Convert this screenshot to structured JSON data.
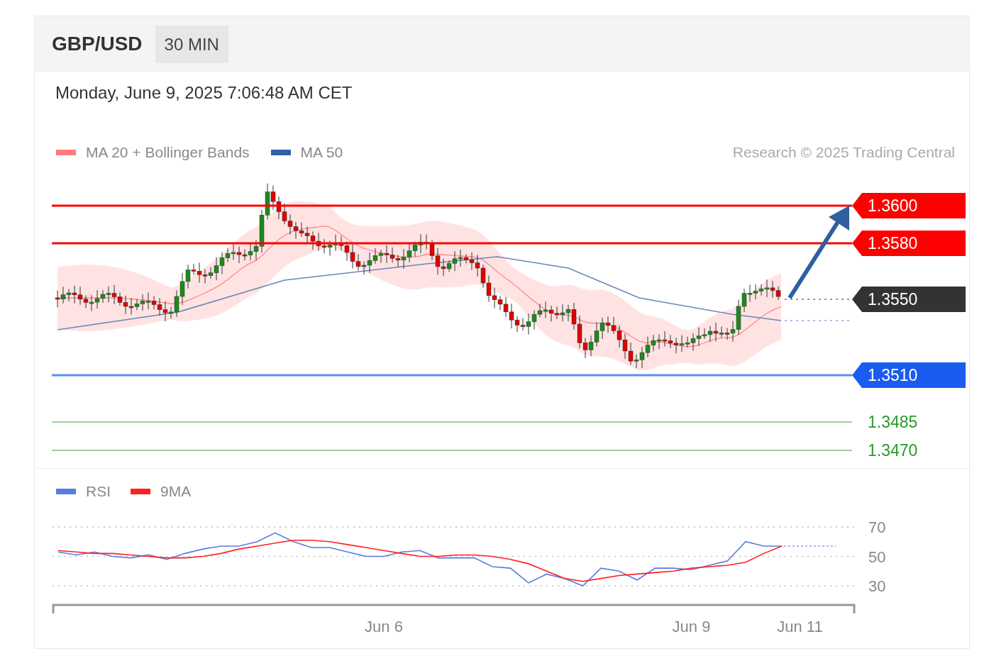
{
  "header": {
    "title": "GBP/USD",
    "interval": "30 MIN"
  },
  "timestamp": "Monday, June 9, 2025 7:06:48 AM CET",
  "price_chart": {
    "legend": [
      {
        "label": "MA 20 + Bollinger Bands",
        "color": "#ff7b7b"
      },
      {
        "label": "MA 50",
        "color": "#2f5fa8"
      }
    ],
    "credit": "Research © 2025 Trading Central",
    "levels": [
      {
        "label": "1.3600",
        "kind": "resistance"
      },
      {
        "label": "1.3580",
        "kind": "resistance"
      },
      {
        "label": "1.3550",
        "kind": "current"
      },
      {
        "label": "1.3510",
        "kind": "support"
      },
      {
        "label": "1.3485",
        "kind": "target"
      },
      {
        "label": "1.3470",
        "kind": "target"
      }
    ]
  },
  "rsi_panel": {
    "chart_data": {
      "type": "line",
      "categories": [
        null,
        null,
        null,
        null,
        null,
        null,
        null,
        null,
        null,
        null,
        null,
        null,
        null,
        null,
        null,
        null,
        null,
        null,
        "Jun 6",
        null,
        null,
        null,
        null,
        null,
        null,
        null,
        null,
        null,
        null,
        null,
        null,
        null,
        null,
        null,
        null,
        "Jun 9",
        null,
        null,
        null,
        null,
        null,
        "Jun 11",
        null,
        null
      ],
      "ylim": [
        17,
        70
      ],
      "yticks": [
        30,
        50,
        70
      ],
      "grid": true,
      "series": [
        {
          "name": "RSI",
          "color": "#5b7be0",
          "values": [
            53,
            51,
            53,
            50,
            49,
            51,
            48,
            52,
            55,
            57,
            57,
            60,
            66,
            60,
            56,
            56,
            53,
            50,
            50,
            53,
            54,
            49,
            49,
            49,
            43,
            42,
            32,
            38,
            35,
            30,
            42,
            40,
            34,
            42,
            42,
            41,
            44,
            47,
            60,
            57,
            57,
            57,
            57,
            57
          ]
        },
        {
          "name": "9MA",
          "color": "#ff2020",
          "values": [
            54,
            53,
            52,
            52,
            51,
            50,
            49,
            49,
            50,
            52,
            55,
            57,
            59,
            61,
            61,
            60,
            58,
            56,
            54,
            52,
            50,
            50,
            51,
            51,
            50,
            48,
            45,
            40,
            35,
            33,
            35,
            37,
            38,
            39,
            40,
            42,
            43,
            44,
            46,
            52,
            57,
            null,
            null,
            null
          ]
        }
      ]
    }
  }
}
